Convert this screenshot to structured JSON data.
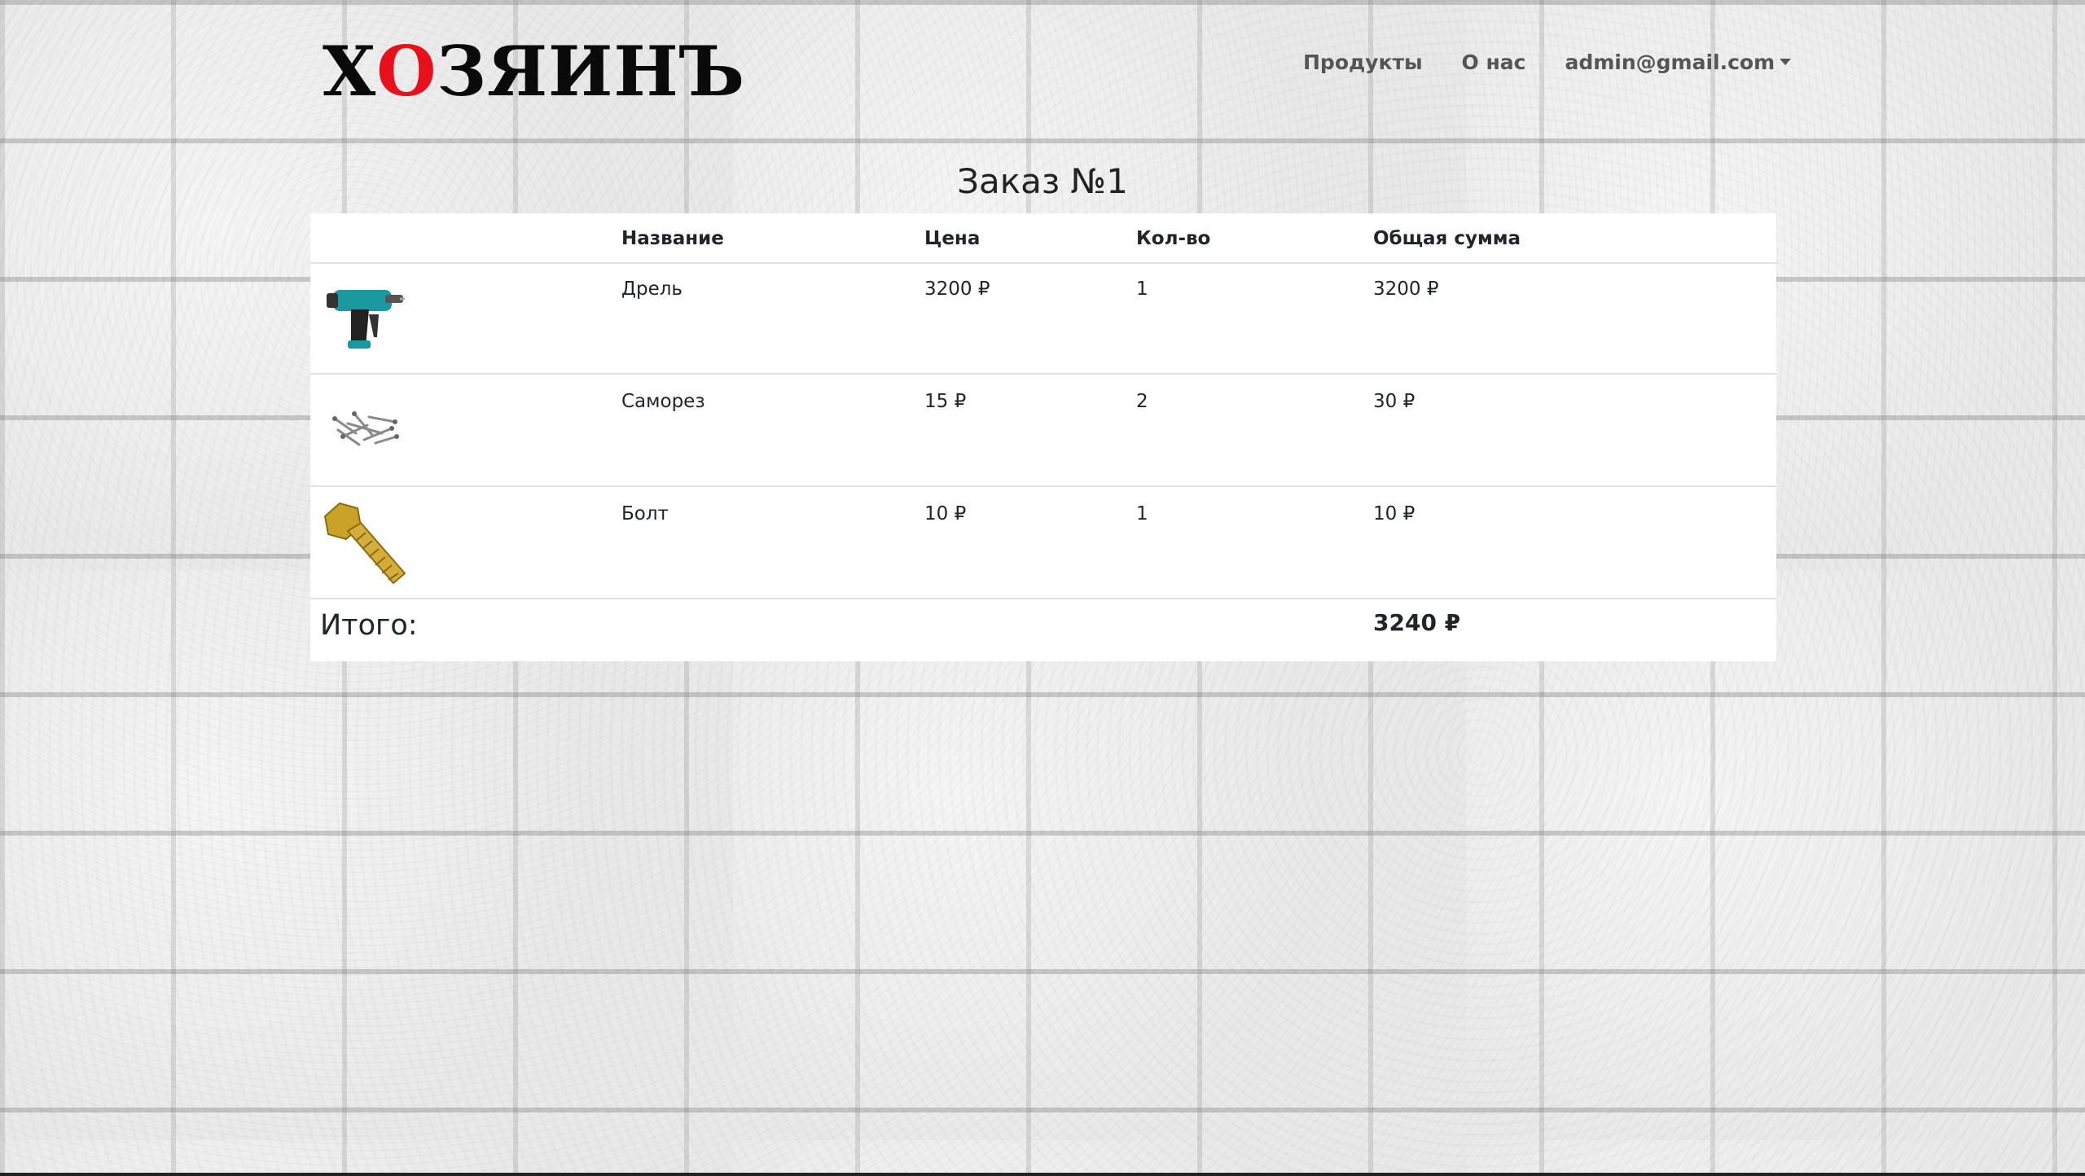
{
  "logo": {
    "part1": "Х",
    "accent": "О",
    "part2": "ЗЯИНЪ",
    "accent_color": "#e8101a"
  },
  "nav": {
    "products": "Продукты",
    "about": "О нас",
    "account": "admin@gmail.com",
    "account_icon": "caret-down-icon"
  },
  "page": {
    "title": "Заказ №1"
  },
  "table": {
    "headers": {
      "image": "",
      "name": "Название",
      "price": "Цена",
      "qty": "Кол-во",
      "sum": "Общая сумма"
    },
    "rows": [
      {
        "image": "drill-image",
        "name": "Дрель",
        "price": "3200 ₽",
        "qty": "1",
        "sum": "3200 ₽"
      },
      {
        "image": "screws-image",
        "name": "Саморез",
        "price": "15 ₽",
        "qty": "2",
        "sum": "30 ₽"
      },
      {
        "image": "bolt-image",
        "name": "Болт",
        "price": "10 ₽",
        "qty": "1",
        "sum": "10 ₽"
      }
    ],
    "total": {
      "label": "Итого:",
      "value": "3240 ₽"
    }
  },
  "colors": {
    "table_bg": "#ffffff",
    "divider": "#dee2e6",
    "nav_text": "#555555"
  }
}
